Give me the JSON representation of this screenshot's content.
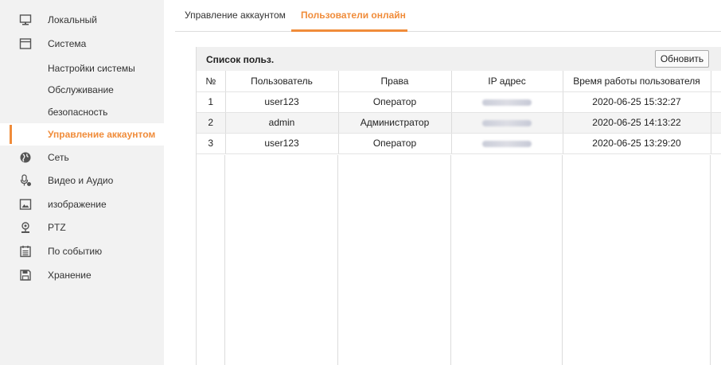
{
  "sidebar": {
    "items": [
      {
        "label": "Локальный",
        "icon": "monitor-icon"
      },
      {
        "label": "Система",
        "icon": "window-icon"
      },
      {
        "label": "Настройки системы"
      },
      {
        "label": "Обслуживание"
      },
      {
        "label": "безопасность"
      },
      {
        "label": "Управление аккаунтом",
        "active": true
      },
      {
        "label": "Сеть",
        "icon": "globe-icon"
      },
      {
        "label": "Видео и Аудио",
        "icon": "microphone-icon"
      },
      {
        "label": "изображение",
        "icon": "image-icon"
      },
      {
        "label": "PTZ",
        "icon": "ptz-camera-icon"
      },
      {
        "label": "По событию",
        "icon": "calendar-icon"
      },
      {
        "label": "Хранение",
        "icon": "floppy-disk-icon"
      }
    ]
  },
  "tabs": [
    {
      "label": "Управление аккаунтом"
    },
    {
      "label": "Пользователи онлайн",
      "active": true
    }
  ],
  "panel": {
    "title": "Список польз.",
    "refresh_label": "Обновить",
    "columns": [
      "№",
      "Пользователь",
      "Права",
      "IP адрес",
      "Время работы пользователя"
    ],
    "rows": [
      {
        "no": "1",
        "user": "user123",
        "rights": "Оператор",
        "time": "2020-06-25 15:32:27"
      },
      {
        "no": "2",
        "user": "admin",
        "rights": "Администратор",
        "time": "2020-06-25 14:13:22"
      },
      {
        "no": "3",
        "user": "user123",
        "rights": "Оператор",
        "time": "2020-06-25 13:29:20"
      }
    ]
  },
  "colors": {
    "accent": "#f08c3a",
    "sidebar_bg": "#f2f2f2",
    "header_bg": "#f0f0f0"
  }
}
